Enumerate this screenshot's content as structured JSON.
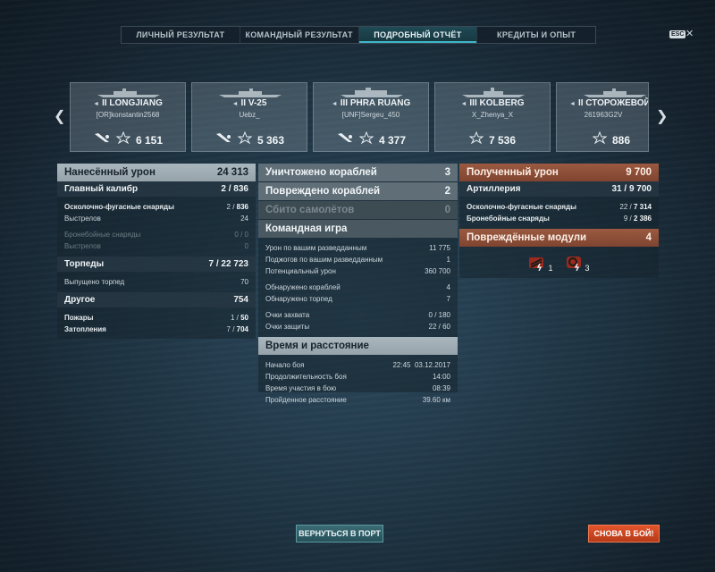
{
  "tabs": [
    {
      "label": "ЛИЧНЫЙ РЕЗУЛЬТАТ"
    },
    {
      "label": "КОМАНДНЫЙ РЕЗУЛЬТАТ"
    },
    {
      "label": "ПОДРОБНЫЙ ОТЧЁТ",
      "active": true
    },
    {
      "label": "КРЕДИТЫ И ОПЫТ"
    }
  ],
  "esc": "ESC",
  "ships": [
    {
      "name": "II LONGJIANG",
      "player": "[OR]konstantin2568",
      "xp": "6 151"
    },
    {
      "name": "II V-25",
      "player": "Uebz_",
      "xp": "5 363"
    },
    {
      "name": "III PHRA RUANG",
      "player": "[UNF]Sergeu_450",
      "xp": "4 377"
    },
    {
      "name": "III KOLBERG",
      "player": "X_Zhenya_X",
      "xp": "7 536"
    },
    {
      "name": "II СТОРОЖЕВОЙ",
      "player": "261963G2V",
      "xp": "886"
    }
  ],
  "left": {
    "dealt_label": "Нанесённый урон",
    "dealt_value": "24 313",
    "main_label": "Главный калибр",
    "main_value": "2 / 836",
    "he_label": "Осколочно-фугасные снаряды",
    "he_hits": "2",
    "he_dmg": "836",
    "shots_label": "Выстрелов",
    "shots_value": "24",
    "ap_label": "Бронебойные снаряды",
    "ap_value": "0 / 0",
    "ap_shots_label": "Выстрелов",
    "ap_shots_value": "0",
    "torp_label": "Торпеды",
    "torp_value": "7 / 22 723",
    "torp_fired_label": "Выпущено торпед",
    "torp_fired_value": "70",
    "other_label": "Другое",
    "other_value": "754",
    "fires_label": "Пожары",
    "fires_hits": "1",
    "fires_dmg": "50",
    "flood_label": "Затопления",
    "flood_hits": "7",
    "flood_dmg": "704"
  },
  "middle": {
    "destroyed_label": "Уничтожено кораблей",
    "destroyed_value": "3",
    "damaged_label": "Повреждено кораблей",
    "damaged_value": "2",
    "planes_label": "Сбито самолётов",
    "planes_value": "0",
    "team_label": "Командная игра",
    "spot_dmg_label": "Урон по вашим разведданным",
    "spot_dmg_value": "11 775",
    "spot_fire_label": "Поджогов по вашим разведданным",
    "spot_fire_value": "1",
    "potential_label": "Потенциальный урон",
    "potential_value": "360 700",
    "spotted_ships_label": "Обнаружено кораблей",
    "spotted_ships_value": "4",
    "spotted_torp_label": "Обнаружено торпед",
    "spotted_torp_value": "7",
    "capture_label": "Очки захвата",
    "capture_value": "0 / 180",
    "defense_label": "Очки защиты",
    "defense_value": "22 / 60",
    "time_label": "Время и расстояние",
    "start_label": "Начало боя",
    "start_time": "22:45",
    "start_date": "03.12.2017",
    "duration_label": "Продолжительность боя",
    "duration_value": "14:00",
    "participation_label": "Время участия в бою",
    "participation_value": "08:39",
    "distance_label": "Пройденное расстояние",
    "distance_value": "39.60 км"
  },
  "right": {
    "received_label": "Полученный урон",
    "received_value": "9 700",
    "art_label": "Артиллерия",
    "art_hits": "31",
    "art_dmg": "9 700",
    "he_label": "Осколочно-фугасные снаряды",
    "he_hits": "22",
    "he_dmg": "7 314",
    "ap_label": "Бронебойные снаряды",
    "ap_hits": "9",
    "ap_dmg": "2 386",
    "modules_label": "Повреждённые модули",
    "modules_value": "4",
    "module1_count": "1",
    "module2_count": "3"
  },
  "buttons": {
    "port": "ВЕРНУТЬСЯ В ПОРТ",
    "fight": "СНОВА В БОЙ!"
  },
  "colors": {
    "accent": "#3fb6c8",
    "received": "#8c4c36",
    "fight": "#d64a22"
  }
}
